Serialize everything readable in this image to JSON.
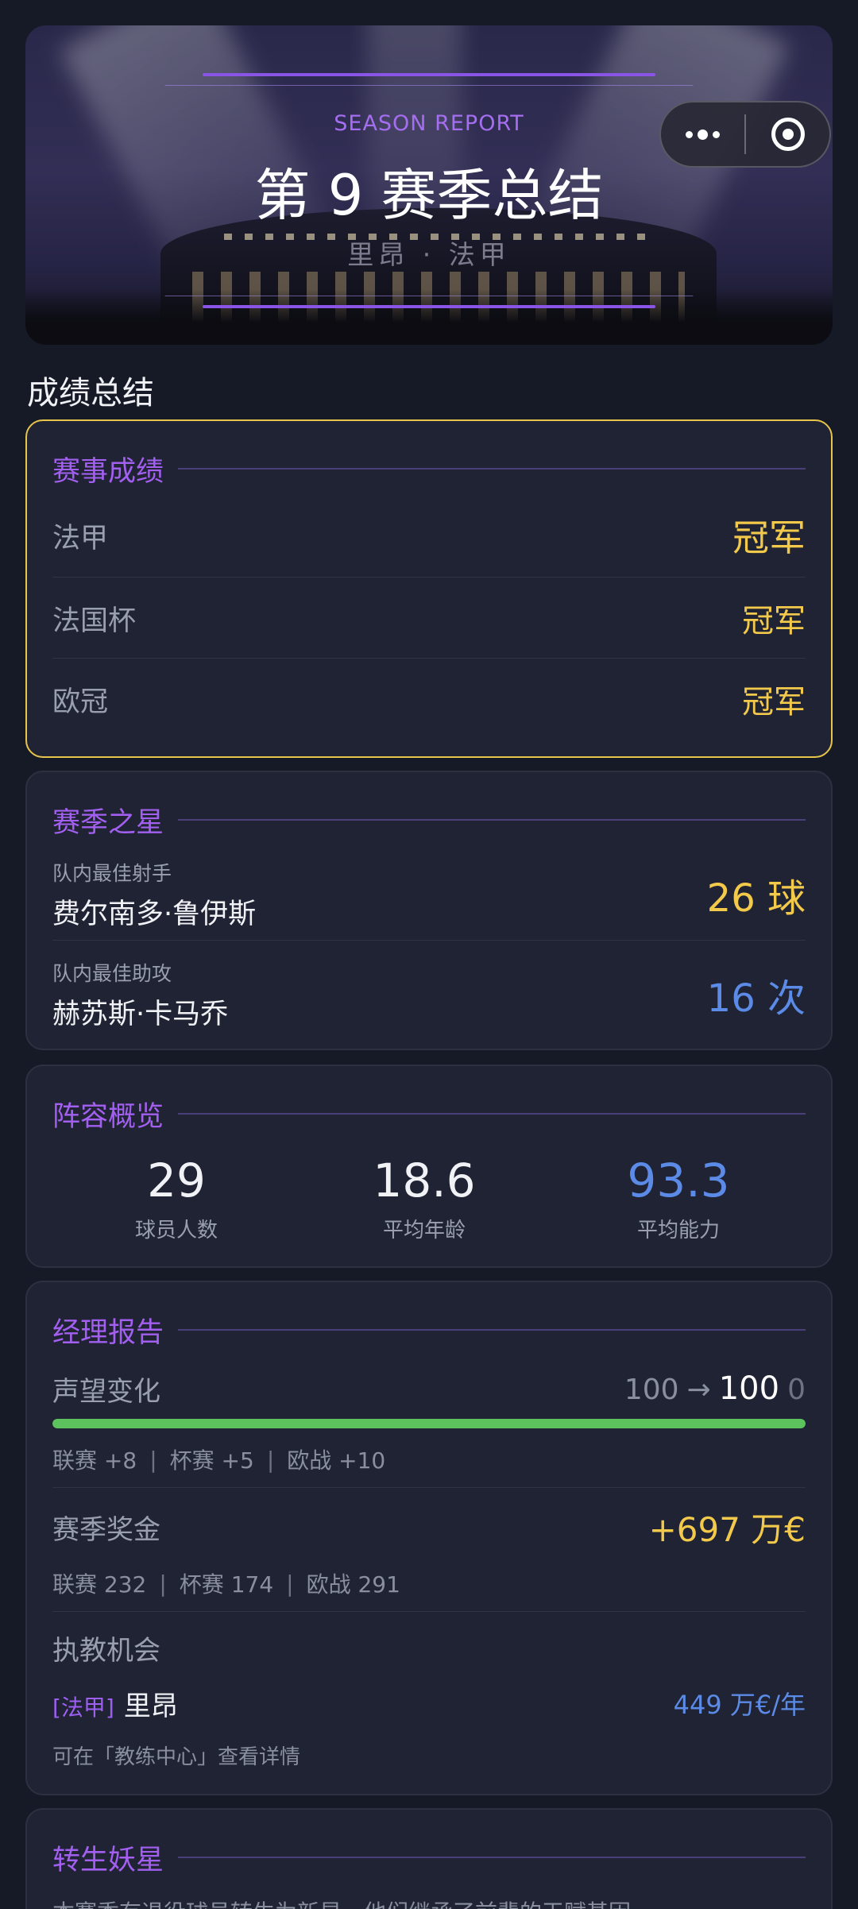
{
  "banner": {
    "subtitle": "SEASON REPORT",
    "title": "第 9 赛季总结",
    "team": "里昂 · 法甲"
  },
  "capsule": {
    "more_icon": "more-dots-icon",
    "close_icon": "target-icon"
  },
  "section_title": "成绩总结",
  "results": {
    "title": "赛事成绩",
    "rows": [
      {
        "competition": "法甲",
        "outcome": "冠军"
      },
      {
        "competition": "法国杯",
        "outcome": "冠军"
      },
      {
        "competition": "欧冠",
        "outcome": "冠军"
      }
    ]
  },
  "stars": {
    "title": "赛季之星",
    "scorer": {
      "caption": "队内最佳射手",
      "name": "费尔南多·鲁伊斯",
      "value": "26 球"
    },
    "assist": {
      "caption": "队内最佳助攻",
      "name": "赫苏斯·卡马乔",
      "value": "16 次"
    }
  },
  "squad": {
    "title": "阵容概览",
    "players": {
      "value": "29",
      "label": "球员人数"
    },
    "age": {
      "value": "18.6",
      "label": "平均年龄"
    },
    "ability": {
      "value": "93.3",
      "label": "平均能力"
    }
  },
  "manager": {
    "title": "经理报告",
    "reputation": {
      "label": "声望变化",
      "from": "100",
      "arrow": "→",
      "to": "100",
      "delta": "0",
      "progress": 1.0,
      "league": "联赛 +8",
      "cup": "杯赛 +5",
      "europe": "欧战 +10"
    },
    "prize": {
      "label": "赛季奖金",
      "value": "+697 万€",
      "league": "联赛 232",
      "cup": "杯赛 174",
      "europe": "欧战 291"
    },
    "offer": {
      "label": "执教机会",
      "league_tag": "[法甲]",
      "club": "里昂",
      "salary": "449 万€/年",
      "hint": "可在「教练中心」查看详情"
    },
    "separator": "|"
  },
  "reborn": {
    "title": "转生妖星",
    "text": "本赛季有退役球员转生为新星，他们继承了前辈的天赋基因"
  },
  "colors": {
    "background": "#161a26",
    "card": "#1f2333",
    "accent_purple": "#a25ff0",
    "gold": "#f3c94b",
    "blue": "#5b8be6",
    "green": "#5cc25d"
  }
}
